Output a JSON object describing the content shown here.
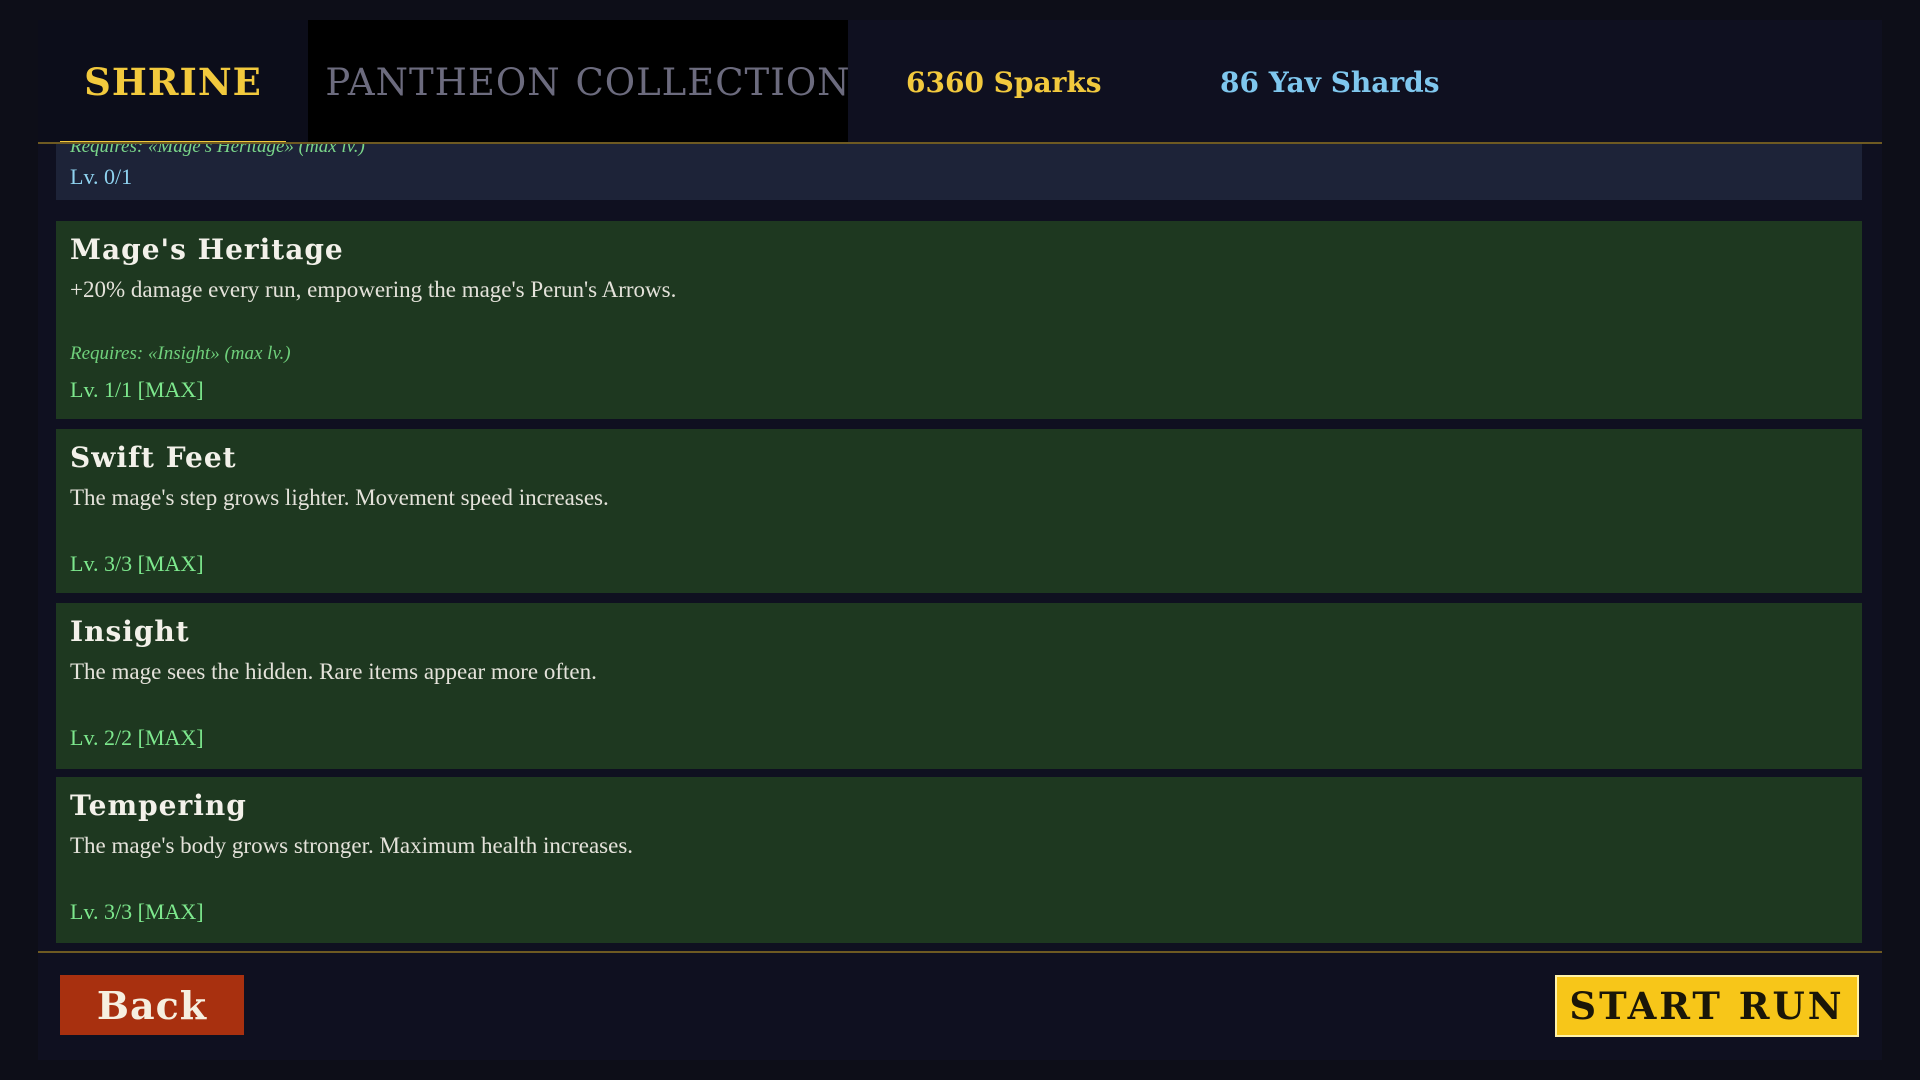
{
  "tabs": [
    {
      "label": "SHRINE",
      "active": true
    },
    {
      "label": "PANTHEON",
      "active": false
    },
    {
      "label": "COLLECTION",
      "active": false
    }
  ],
  "currency": {
    "sparks": "6360 Sparks",
    "shards": "86 Yav Shards"
  },
  "colors": {
    "accent_gold": "#f2c93d",
    "shard_blue": "#7fc7ee",
    "card_green": "#1e3820",
    "card_locked": "#1d2338",
    "max_green": "#7de88d",
    "back_red": "#a8300f",
    "start_yellow": "#f7c619"
  },
  "upgrades": [
    {
      "name": "",
      "description": "",
      "requires": "Requires: «Mage's Heritage» (max lv.)",
      "level": "Lv. 0/1",
      "locked": true
    },
    {
      "name": "Mage's Heritage",
      "description": "+20% damage every run, empowering the mage's Perun's Arrows.",
      "requires": "Requires: «Insight» (max lv.)",
      "level": "Lv. 1/1  [MAX]"
    },
    {
      "name": "Swift Feet",
      "description": "The mage's step grows lighter. Movement speed increases.",
      "level": "Lv. 3/3  [MAX]"
    },
    {
      "name": "Insight",
      "description": "The mage sees the hidden. Rare items appear more often.",
      "level": "Lv. 2/2  [MAX]"
    },
    {
      "name": "Tempering",
      "description": "The mage's body grows stronger. Maximum health increases.",
      "level": "Lv. 3/3  [MAX]"
    }
  ],
  "buttons": {
    "back": "Back",
    "start_run": "START RUN"
  }
}
